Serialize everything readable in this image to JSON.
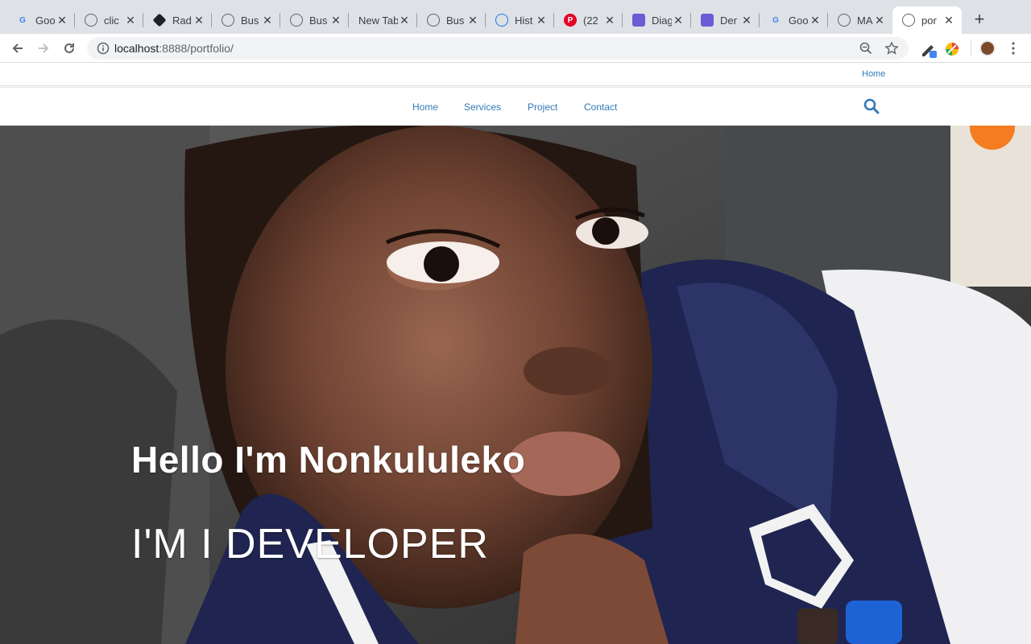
{
  "browser": {
    "tabs": [
      {
        "title": "Goo",
        "icon": "google-icon",
        "icon_color": "#4285f4",
        "icon_char": "G"
      },
      {
        "title": "clic",
        "icon": "globe-icon",
        "icon_color": "#5f6368",
        "icon_char": ""
      },
      {
        "title": "Rad",
        "icon": "radix-icon",
        "icon_color": "#202124",
        "icon_char": ""
      },
      {
        "title": "Bus",
        "icon": "globe-icon",
        "icon_color": "#5f6368",
        "icon_char": ""
      },
      {
        "title": "Bus",
        "icon": "globe-icon",
        "icon_color": "#5f6368",
        "icon_char": ""
      },
      {
        "title": "New Tab",
        "icon": "none",
        "icon_color": "",
        "icon_char": ""
      },
      {
        "title": "Bus",
        "icon": "globe-icon",
        "icon_color": "#5f6368",
        "icon_char": ""
      },
      {
        "title": "Hist",
        "icon": "history-icon",
        "icon_color": "#1a73e8",
        "icon_char": ""
      },
      {
        "title": "(22",
        "icon": "pinterest-icon",
        "icon_color": "#e60023",
        "icon_char": "P"
      },
      {
        "title": "Diag",
        "icon": "diagram-icon",
        "icon_color": "#6b5bd6",
        "icon_char": ""
      },
      {
        "title": "Der",
        "icon": "diagram-icon",
        "icon_color": "#6b5bd6",
        "icon_char": ""
      },
      {
        "title": "Goo",
        "icon": "google-icon",
        "icon_color": "#4285f4",
        "icon_char": "G"
      },
      {
        "title": "MA",
        "icon": "github-icon",
        "icon_color": "#5f6368",
        "icon_char": ""
      },
      {
        "title": "por",
        "icon": "github-icon",
        "icon_color": "#5f6368",
        "icon_char": ""
      }
    ],
    "url_host": "localhost",
    "url_rest": ":8888/portfolio/"
  },
  "site": {
    "top_link": "Home",
    "nav": [
      "Home",
      "Services",
      "Project",
      "Contact"
    ],
    "link_color": "#337ab7"
  },
  "hero": {
    "title": "Hello I'm Nonkululeko",
    "subtitle": "I'M I DEVELOPER"
  }
}
